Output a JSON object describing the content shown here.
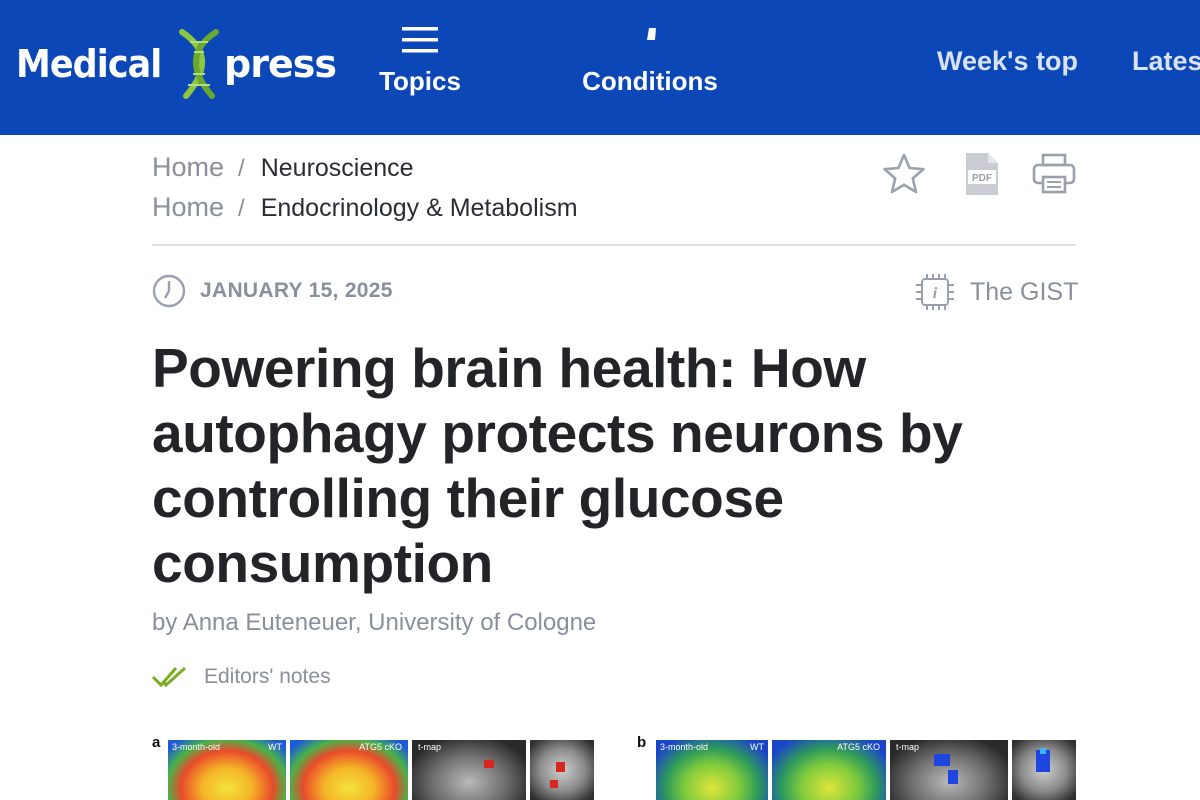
{
  "header": {
    "logo": {
      "word1": "Medical",
      "word2": "press"
    },
    "nav": {
      "topics": "Topics",
      "conditions": "Conditions",
      "weeks_top": "Week's top",
      "latest": "Lates"
    },
    "colors": {
      "bar": "#0b47b6",
      "logo_x": "#8dc63f"
    }
  },
  "breadcrumbs": [
    {
      "home": "Home",
      "separator": "/",
      "category": "Neuroscience"
    },
    {
      "home": "Home",
      "separator": "/",
      "category": "Endocrinology & Metabolism"
    }
  ],
  "tools": {
    "icons": [
      "star-icon",
      "pdf-icon",
      "print-icon"
    ],
    "pdf_text": "PDF"
  },
  "meta": {
    "date": "JANUARY 15, 2025",
    "gist_label": "The GIST"
  },
  "article": {
    "title": "Powering brain health: How autophagy protects neurons by controlling their glucose consumption",
    "byline": "by Anna Euteneuer, University of Cologne",
    "editors_notes": "Editors' notes"
  },
  "figure": {
    "panel_a": {
      "letter": "a",
      "labels": [
        "3-month-old",
        "WT",
        "ATG5 cKO",
        "t-map"
      ]
    },
    "panel_b": {
      "letter": "b",
      "labels": [
        "3-month-old",
        "WT",
        "ATG5 cKO",
        "t-map"
      ]
    }
  }
}
